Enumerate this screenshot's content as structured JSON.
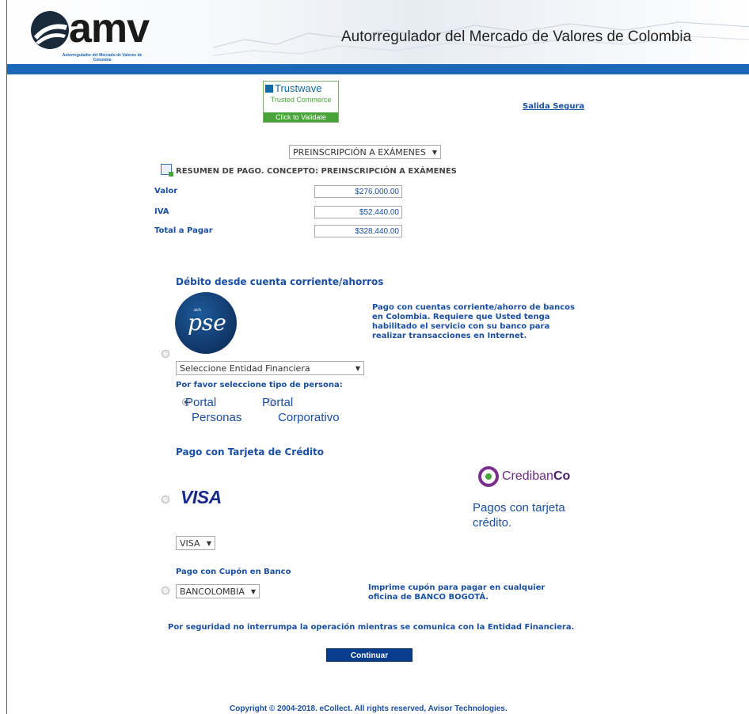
{
  "header": {
    "logo_text": "amv",
    "logo_subtitle": "Autorregulador del Mercado de Valores de Colombia",
    "title": "Autorregulador del Mercado de Valores de Colombia",
    "brand_color": "#1a68b6"
  },
  "trust_badge": {
    "brand": "Trustwave",
    "line2": "Trusted Commerce",
    "cta": "Click to Validate"
  },
  "links": {
    "salida_segura": "Salida Segura"
  },
  "concept": {
    "selected": "PREINSCRIPCIÓN A EXÁMENES",
    "summary_title": "RESUMEN DE PAGO. CONCEPTO: PREINSCRIPCIÓN A EXÁMENES"
  },
  "amounts": [
    {
      "label": "Valor",
      "value": "$276,000.00"
    },
    {
      "label": "IVA",
      "value": "$52,440.00"
    },
    {
      "label": "Total a Pagar",
      "value": "$328,440.00"
    }
  ],
  "debit": {
    "title": "Débito desde cuenta corriente/ahorros",
    "logo_text": "pse",
    "logo_small": "ach",
    "description": "Pago con cuentas corriente/ahorro de bancos en Colombia. Requiere que Usted tenga habilitado el servicio con su banco para realizar transacciones en Internet.",
    "bank_select": "Seleccione Entidad Financiera",
    "person_prompt": "Por favor seleccione tipo de persona:",
    "person_options": [
      "Portal Personas",
      "Portal Corporativo"
    ],
    "selected_person": "Portal Personas"
  },
  "credit": {
    "title": "Pago con Tarjeta de Crédito",
    "card_logo": "VISA",
    "provider_name_a": "Crediban",
    "provider_name_b": "Co",
    "provider_text": "Pagos con tarjeta crédito.",
    "card_select": "VISA"
  },
  "coupon": {
    "title": "Pago con Cupón en Banco",
    "bank_select": "BANCOLOMBIA",
    "description": "Imprime cupón para pagar en cualquier oficina de BANCO BOGOTÁ."
  },
  "security_note": "Por seguridad no interrumpa la operación mientras se comunica con la Entidad Financiera.",
  "submit_label": "Continuar",
  "copyright": "Copyright © 2004-2018. eCollect. All rights reserved, Avisor Technologies."
}
